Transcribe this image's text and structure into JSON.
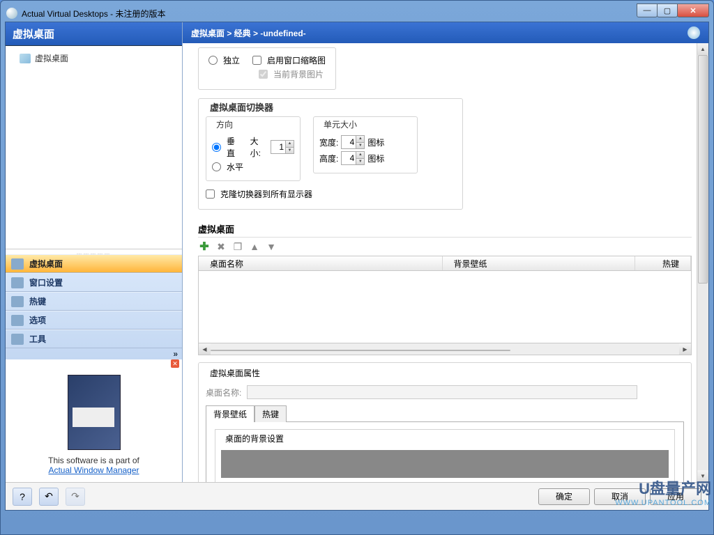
{
  "title": "Actual Virtual Desktops - 未注册的版本",
  "left": {
    "header": "虚拟桌面",
    "tree_root": "虚拟桌面"
  },
  "nav": {
    "items": [
      {
        "label": "虚拟桌面"
      },
      {
        "label": "窗口设置"
      },
      {
        "label": "热键"
      },
      {
        "label": "选项"
      },
      {
        "label": "工具"
      }
    ]
  },
  "promo": {
    "text": "This software is a part of",
    "link": "Actual Window Manager"
  },
  "breadcrumb": "虚拟桌面 > 经典 > -undefined-",
  "top": {
    "radio_independent": "独立",
    "chk_thumb": "启用窗口缩略图",
    "chk_bg": "当前背景图片"
  },
  "switcher": {
    "title": "虚拟桌面切换器",
    "dir_label": "方向",
    "opt_v": "垂直",
    "opt_h": "水平",
    "size_label": "大小:",
    "size_val": "1",
    "cell_label": "单元大小",
    "width_label": "宽度:",
    "width_val": "4",
    "height_label": "高度:",
    "height_val": "4",
    "unit": "图标",
    "clone": "克隆切换器到所有显示器"
  },
  "desks": {
    "title": "虚拟桌面",
    "columns": {
      "name": "桌面名称",
      "wallpaper": "背景壁纸",
      "hotkey": "热键"
    }
  },
  "props": {
    "title": "虚拟桌面属性",
    "name_label": "桌面名称:",
    "tab_wall": "背景壁纸",
    "tab_hotkey": "热键",
    "bg_title": "桌面的背景设置"
  },
  "buttons": {
    "ok": "确定",
    "cancel": "取消",
    "apply": "应用"
  },
  "watermark": {
    "brand": "U盘量产网",
    "url": "WWW.UPANTOOL.COM"
  }
}
